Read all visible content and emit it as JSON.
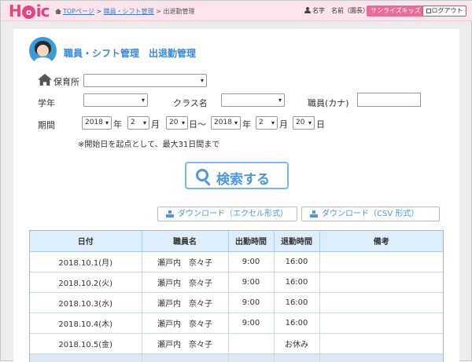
{
  "header": {
    "logo_text": "Hoic",
    "breadcrumb": [
      "TOPページ",
      "職員・シフト管理",
      "出退勤管理"
    ],
    "breadcrumb_sep": ">",
    "user_label": "名字　名前（園長）",
    "nursery": "サンライズキッズ",
    "logout": "ログアウト"
  },
  "page": {
    "title": "職員・シフト管理　出退勤管理"
  },
  "filters": {
    "nursery_label": "保育所",
    "nursery_value": "",
    "grade_label": "学年",
    "grade_value": "",
    "class_label": "クラス名",
    "class_value": "",
    "staff_label": "職員(カナ)",
    "staff_value": "",
    "period_label": "期間",
    "from": {
      "year": "2018",
      "month": "2",
      "day": "20"
    },
    "to": {
      "year": "2018",
      "month": "2",
      "day": "20"
    },
    "unit_year": "年",
    "unit_month": "月",
    "unit_day_from": "日～",
    "unit_day_to": "日",
    "note": "※開始日を起点として、最大31日間まで"
  },
  "actions": {
    "search": "検索する",
    "download_excel": "ダウンロード（エクセル形式）",
    "download_csv": "ダウンロード（CSV 形式）"
  },
  "table": {
    "columns": [
      "日付",
      "職員名",
      "出勤時間",
      "退勤時間",
      "備考"
    ],
    "rows": [
      [
        "2018.10.1(月)",
        "瀬戸内　奈々子",
        "9:00",
        "16:00",
        ""
      ],
      [
        "2018.10.2(火)",
        "瀬戸内　奈々子",
        "9:00",
        "16:00",
        ""
      ],
      [
        "2018.10.3(水)",
        "瀬戸内　奈々子",
        "9:00",
        "16:00",
        ""
      ],
      [
        "2018.10.4(木)",
        "瀬戸内　奈々子",
        "9:00",
        "16:00",
        ""
      ],
      [
        "2018.10.5(金)",
        "瀬戸内　奈々子",
        "",
        "お休み",
        ""
      ]
    ]
  },
  "colors": {
    "accent_pink": "#e8437a",
    "accent_blue": "#4f97dc",
    "header_bg": "#fbe4ec",
    "table_header_bg": "#deedfa"
  }
}
